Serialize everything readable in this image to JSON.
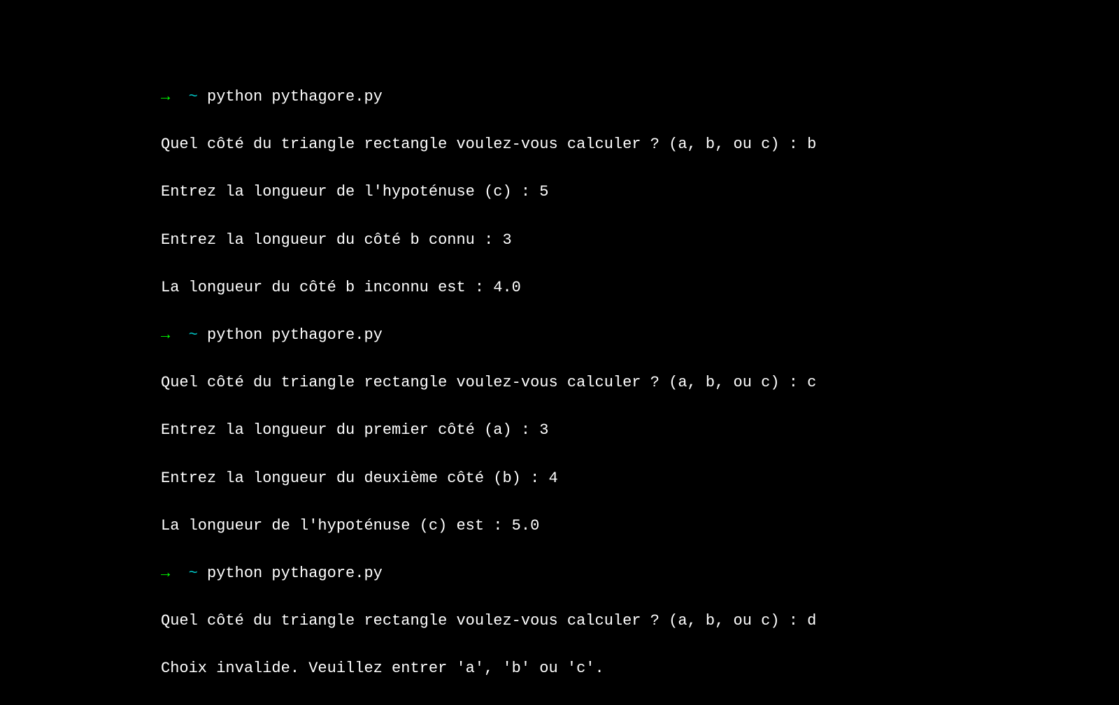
{
  "prompt": {
    "arrow": "→",
    "tilde": "~"
  },
  "runs": [
    {
      "command": "python pythagore.py",
      "outputs": [
        "Quel côté du triangle rectangle voulez-vous calculer ? (a, b, ou c) : b",
        "Entrez la longueur de l'hypoténuse (c) : 5",
        "Entrez la longueur du côté b connu : 3",
        "La longueur du côté b inconnu est : 4.0"
      ]
    },
    {
      "command": "python pythagore.py",
      "outputs": [
        "Quel côté du triangle rectangle voulez-vous calculer ? (a, b, ou c) : c",
        "Entrez la longueur du premier côté (a) : 3",
        "Entrez la longueur du deuxième côté (b) : 4",
        "La longueur de l'hypoténuse (c) est : 5.0"
      ]
    },
    {
      "command": "python pythagore.py",
      "outputs": [
        "Quel côté du triangle rectangle voulez-vous calculer ? (a, b, ou c) : d",
        "Choix invalide. Veuillez entrer 'a', 'b' ou 'c'."
      ]
    }
  ]
}
